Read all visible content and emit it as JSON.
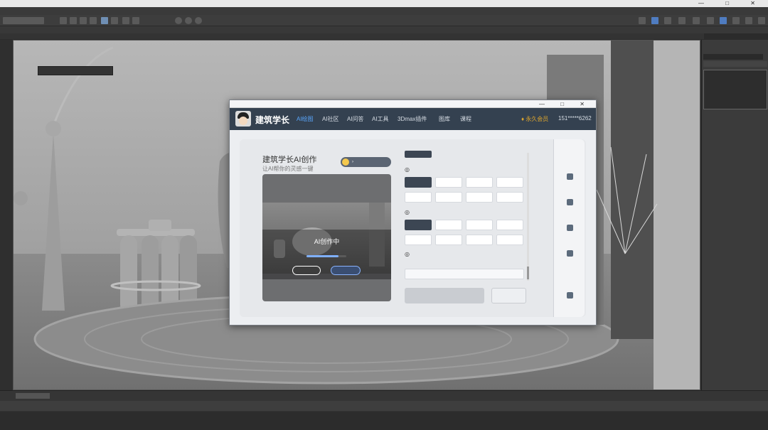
{
  "app": {
    "title": "",
    "window_controls": "— □ ✕"
  },
  "menubar": {
    "items": [
      "",
      "",
      "",
      "",
      "",
      "",
      "",
      "",
      "",
      "",
      "",
      "",
      "",
      ""
    ]
  },
  "ribbon": {
    "tabs": [
      "",
      "",
      "",
      "",
      ""
    ]
  },
  "viewport": {
    "label": ""
  },
  "command_panel": {
    "field": "",
    "list": ""
  },
  "timeline": {
    "frame": ""
  },
  "dialog": {
    "title": "",
    "brand": "建筑学长",
    "nav": [
      {
        "label": "AI绘图",
        "active": true
      },
      {
        "label": "AI社区",
        "active": false
      },
      {
        "label": "AI问答",
        "active": false
      },
      {
        "label": "AI工具",
        "active": false
      },
      {
        "label": "3Dmax插件",
        "active": false
      },
      {
        "label": "图库",
        "active": false
      },
      {
        "label": "课程",
        "active": false
      }
    ],
    "vip": "永久会员",
    "phone": "151*****6262",
    "ai_title": "建筑学长AI创作",
    "ai_sub": "让AI帮你的灵感一键",
    "case_button": "",
    "overlay_title": "AI创作中",
    "overlay_sub": "",
    "progress": 0.8,
    "btn_edit": "",
    "btn_fav": "",
    "section_tag": "",
    "style_label": "",
    "style_chips": [
      "",
      "",
      "",
      "",
      "",
      "",
      "",
      ""
    ],
    "space_label": "",
    "space_chips": [
      "",
      "",
      "",
      "",
      "",
      "",
      "",
      ""
    ],
    "neg_label": "",
    "neg_hint": "",
    "neg_placeholder": "",
    "neg_count": "",
    "create_button": "",
    "next_button": "",
    "rail": [
      {
        "label": ""
      },
      {
        "label": ""
      },
      {
        "label": ""
      },
      {
        "label": ""
      },
      {
        "label": ""
      },
      {
        "label": ""
      }
    ]
  }
}
